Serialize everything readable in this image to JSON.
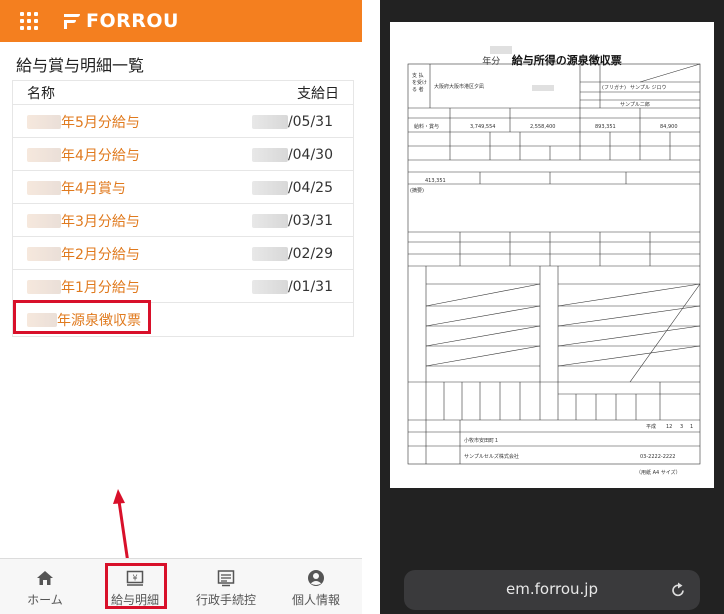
{
  "app": {
    "brand": "FORROU",
    "brand_color": "#f47f1f"
  },
  "page": {
    "title": "給与賞与明細一覧",
    "columns": {
      "name": "名称",
      "pay_date": "支給日"
    }
  },
  "payslips": [
    {
      "label": "年5月分給与",
      "date": "/05/31"
    },
    {
      "label": "年4月分給与",
      "date": "/04/30"
    },
    {
      "label": "年4月賞与",
      "date": "/04/25"
    },
    {
      "label": "年3月分給与",
      "date": "/03/31"
    },
    {
      "label": "年2月分給与",
      "date": "/02/29"
    },
    {
      "label": "年1月分給与",
      "date": "/01/31"
    }
  ],
  "withholding": {
    "label": "年源泉徴収票"
  },
  "bottom_nav": [
    {
      "label": "ホーム",
      "icon": "home-icon"
    },
    {
      "label": "給与明細",
      "icon": "yen-slip-icon"
    },
    {
      "label": "行政手続控",
      "icon": "document-list-icon"
    },
    {
      "label": "個人情報",
      "icon": "person-icon"
    }
  ],
  "browser": {
    "url": "em.forrou.jp"
  },
  "document": {
    "year_suffix": "年分",
    "title": "給与所得の源泉徴収票",
    "address": "大阪府大阪市港区夕凪",
    "name_kana": "サンプル ジロウ",
    "name": "サンプル二郎",
    "pay_type": "給料・賞与",
    "amount1": "3,749,554",
    "amount2": "2,558,400",
    "amount3": "893,351",
    "amount4": "84,900",
    "social_insurance": "413,351",
    "era": "平成",
    "date_nums": [
      "12",
      "3",
      "1"
    ],
    "payer_address": "小牧市安田町１",
    "payer_name": "サンプルセルズ株式会社",
    "payer_tel": "03-2222-2222",
    "footer": "（用紙 A4 サイズ）"
  }
}
